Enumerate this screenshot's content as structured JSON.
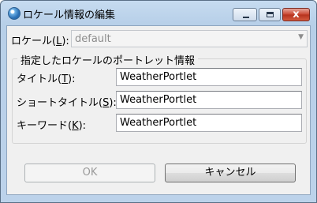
{
  "window": {
    "title": "ロケール情報の編集",
    "close_glyph": "x"
  },
  "locale": {
    "label_prefix": "ロケール(",
    "label_key": "L",
    "label_suffix": "):",
    "value": "default"
  },
  "group": {
    "title": "指定したロケールのポートレット情報",
    "fields": [
      {
        "label_prefix": "タイトル(",
        "key": "T",
        "label_suffix": "):",
        "value": "WeatherPortlet"
      },
      {
        "label_prefix": "ショートタイトル(",
        "key": "S",
        "label_suffix": "):",
        "value": "WeatherPortlet"
      },
      {
        "label_prefix": "キーワード(",
        "key": "K",
        "label_suffix": "):",
        "value": "WeatherPortlet"
      }
    ]
  },
  "buttons": {
    "ok": "OK",
    "cancel": "キャンセル"
  },
  "colors": {
    "title_bar": "#c6dbf0",
    "close_button": "#c9452f",
    "dialog_bg": "#f0f0f0"
  }
}
